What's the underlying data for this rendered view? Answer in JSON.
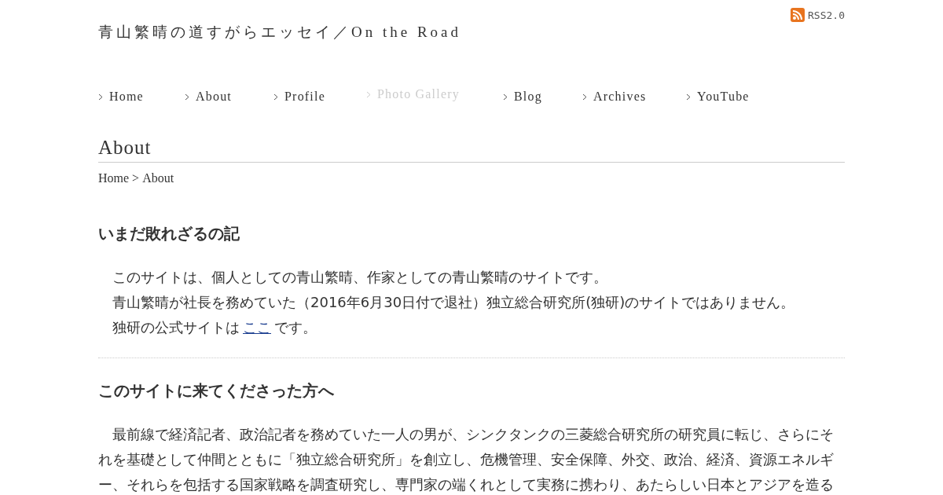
{
  "header": {
    "site_title": "青山繁晴の道すがらエッセイ／On the Road",
    "rss_label": "RSS2.0"
  },
  "nav": [
    {
      "label": "Home",
      "disabled": false
    },
    {
      "label": "About",
      "disabled": false
    },
    {
      "label": "Profile",
      "disabled": false
    },
    {
      "label": "Photo Gallery",
      "disabled": true
    },
    {
      "label": "Blog",
      "disabled": false
    },
    {
      "label": "Archives",
      "disabled": false
    },
    {
      "label": "YouTube",
      "disabled": false
    }
  ],
  "page_title": "About",
  "breadcrumb": {
    "link": "Home",
    "separator": ">",
    "current": "About"
  },
  "sections": [
    {
      "heading": "いまだ敗れざるの記",
      "lines": [
        {
          "text": "このサイトは、個人としての青山繁晴、作家としての青山繁晴のサイトです。"
        },
        {
          "text": "青山繁晴が社長を務めていた（2016年6月30日付で退社）独立総合研究所(独研)のサイトではありません。"
        },
        {
          "text": "独研の公式サイトは",
          "link": "ここ",
          "after": "です。"
        }
      ]
    },
    {
      "heading": "このサイトに来てくださった方へ",
      "paragraph": "最前線で経済記者、政治記者を務めていた一人の男が、シンクタンクの三菱総合研究所の研究員に転じ、さらにそれを基礎として仲間とともに「独立総合研究所」を創立し、危機管理、安全保障、外交、政治、経済、資源エネルギー、それらを包括する国家戦略を調査研究し、専門家の端くれとして実務に携わり、あたらしい日本とアジアを造る"
    }
  ]
}
